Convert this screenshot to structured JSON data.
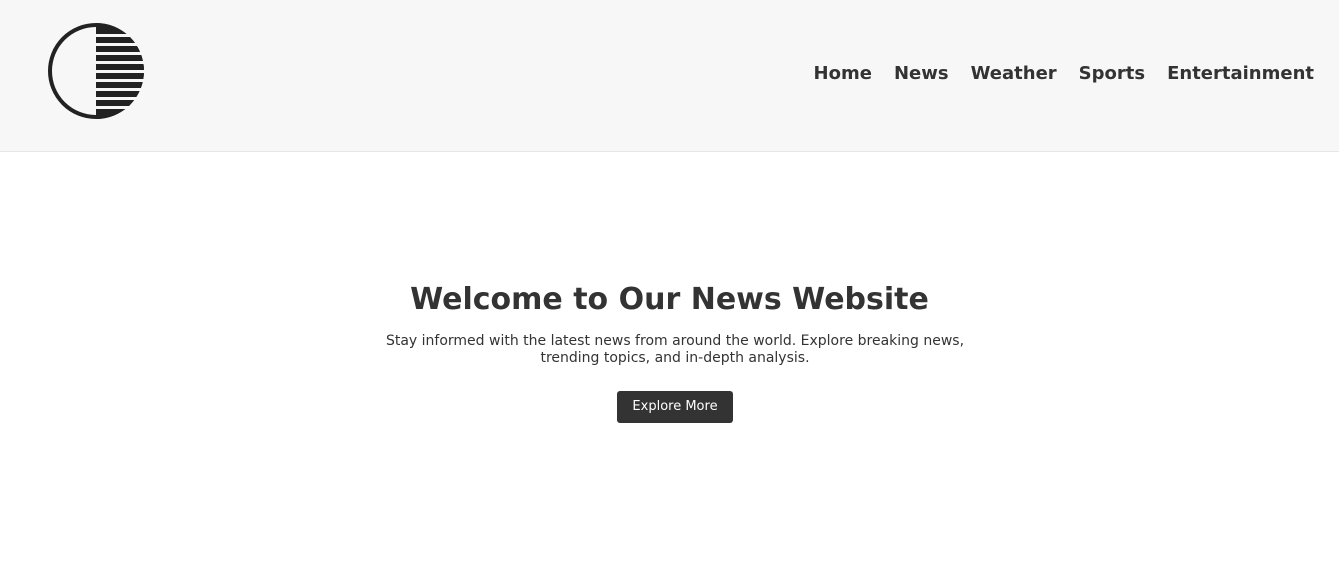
{
  "header": {
    "logo_icon": "striped-circle-logo",
    "nav": {
      "home": "Home",
      "news": "News",
      "weather": "Weather",
      "sports": "Sports",
      "entertainment": "Entertainment"
    }
  },
  "hero": {
    "title": "Welcome to Our News Website",
    "description": "Stay informed with the latest news from around the world. Explore breaking news, trending topics, and in-depth analysis.",
    "button_label": "Explore More"
  },
  "colors": {
    "header_background": "#f7f7f7",
    "text": "#333333",
    "button_background": "#333333",
    "button_text": "#ffffff"
  }
}
